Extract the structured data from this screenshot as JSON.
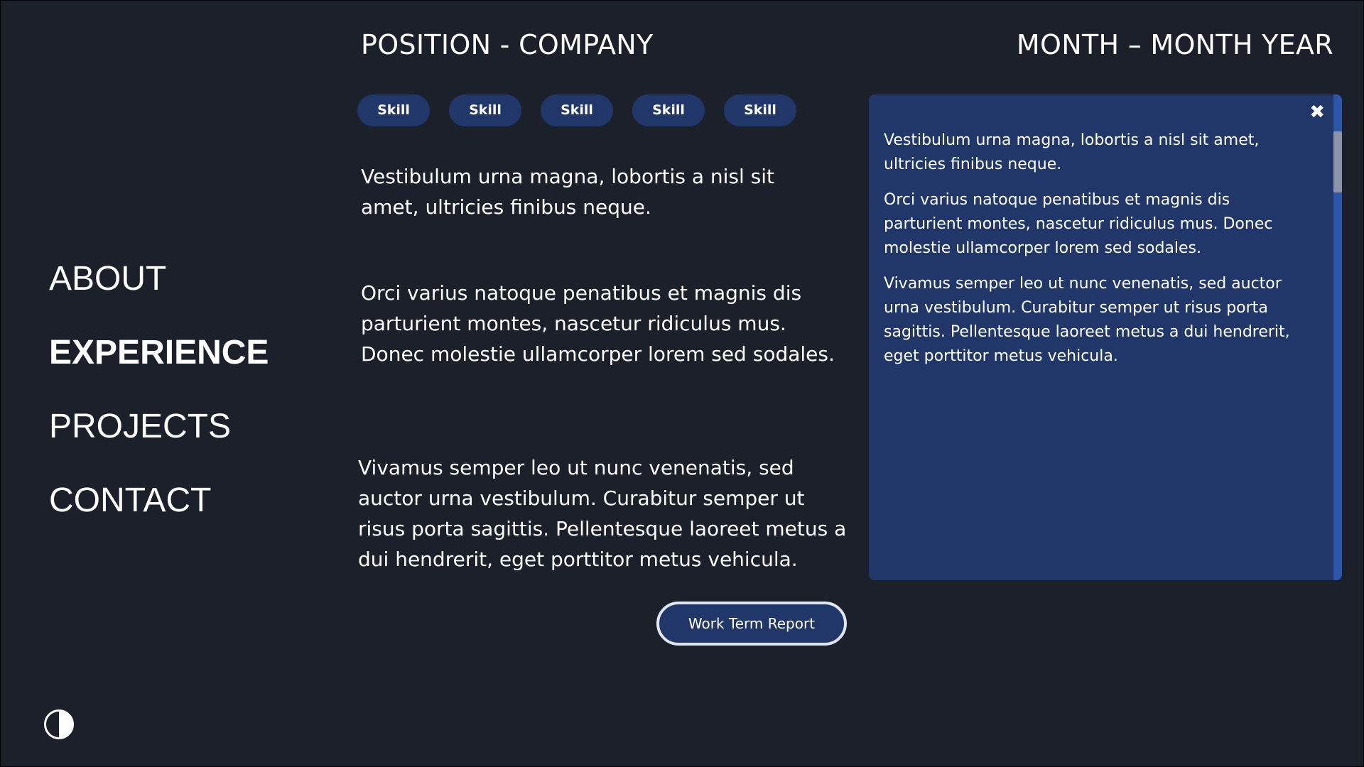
{
  "nav": {
    "items": [
      {
        "label": "ABOUT",
        "active": false
      },
      {
        "label": "EXPERIENCE",
        "active": true
      },
      {
        "label": "PROJECTS",
        "active": false
      },
      {
        "label": "CONTACT",
        "active": false
      }
    ]
  },
  "header": {
    "position_company": "POSITION - COMPANY",
    "date_range": "MONTH – MONTH YEAR"
  },
  "skills": [
    "Skill",
    "Skill",
    "Skill",
    "Skill",
    "Skill"
  ],
  "main": {
    "paragraphs": [
      "Vestibulum urna magna, lobortis a nisl sit amet, ultricies finibus neque.",
      "Orci varius natoque penatibus et magnis dis parturient montes, nascetur ridiculus mus. Donec molestie ullamcorper lorem sed sodales.",
      "Vivamus semper leo ut nunc venenatis, sed auctor urna vestibulum. Curabitur semper ut risus porta sagittis. Pellentesque laoreet metus a dui hendrerit, eget porttitor metus vehicula."
    ],
    "report_button_label": "Work Term Report"
  },
  "panel": {
    "close_symbol": "✖",
    "paragraphs": [
      "Vestibulum urna magna, lobortis a nisl sit amet, ultricies finibus neque.",
      "Orci varius natoque penatibus et magnis dis parturient montes, nascetur ridiculus mus. Donec molestie ullamcorper lorem sed sodales.",
      "Vivamus semper leo ut nunc venenatis, sed auctor urna vestibulum. Curabitur semper ut risus porta sagittis. Pellentesque laoreet metus a dui hendrerit, eget porttitor metus vehicula."
    ]
  },
  "theme_toggle": {
    "icon": "contrast-icon"
  },
  "colors": {
    "background": "#1c202b",
    "accent": "#223769",
    "scrollbar": "#2c57a8",
    "text": "#ffffff"
  }
}
